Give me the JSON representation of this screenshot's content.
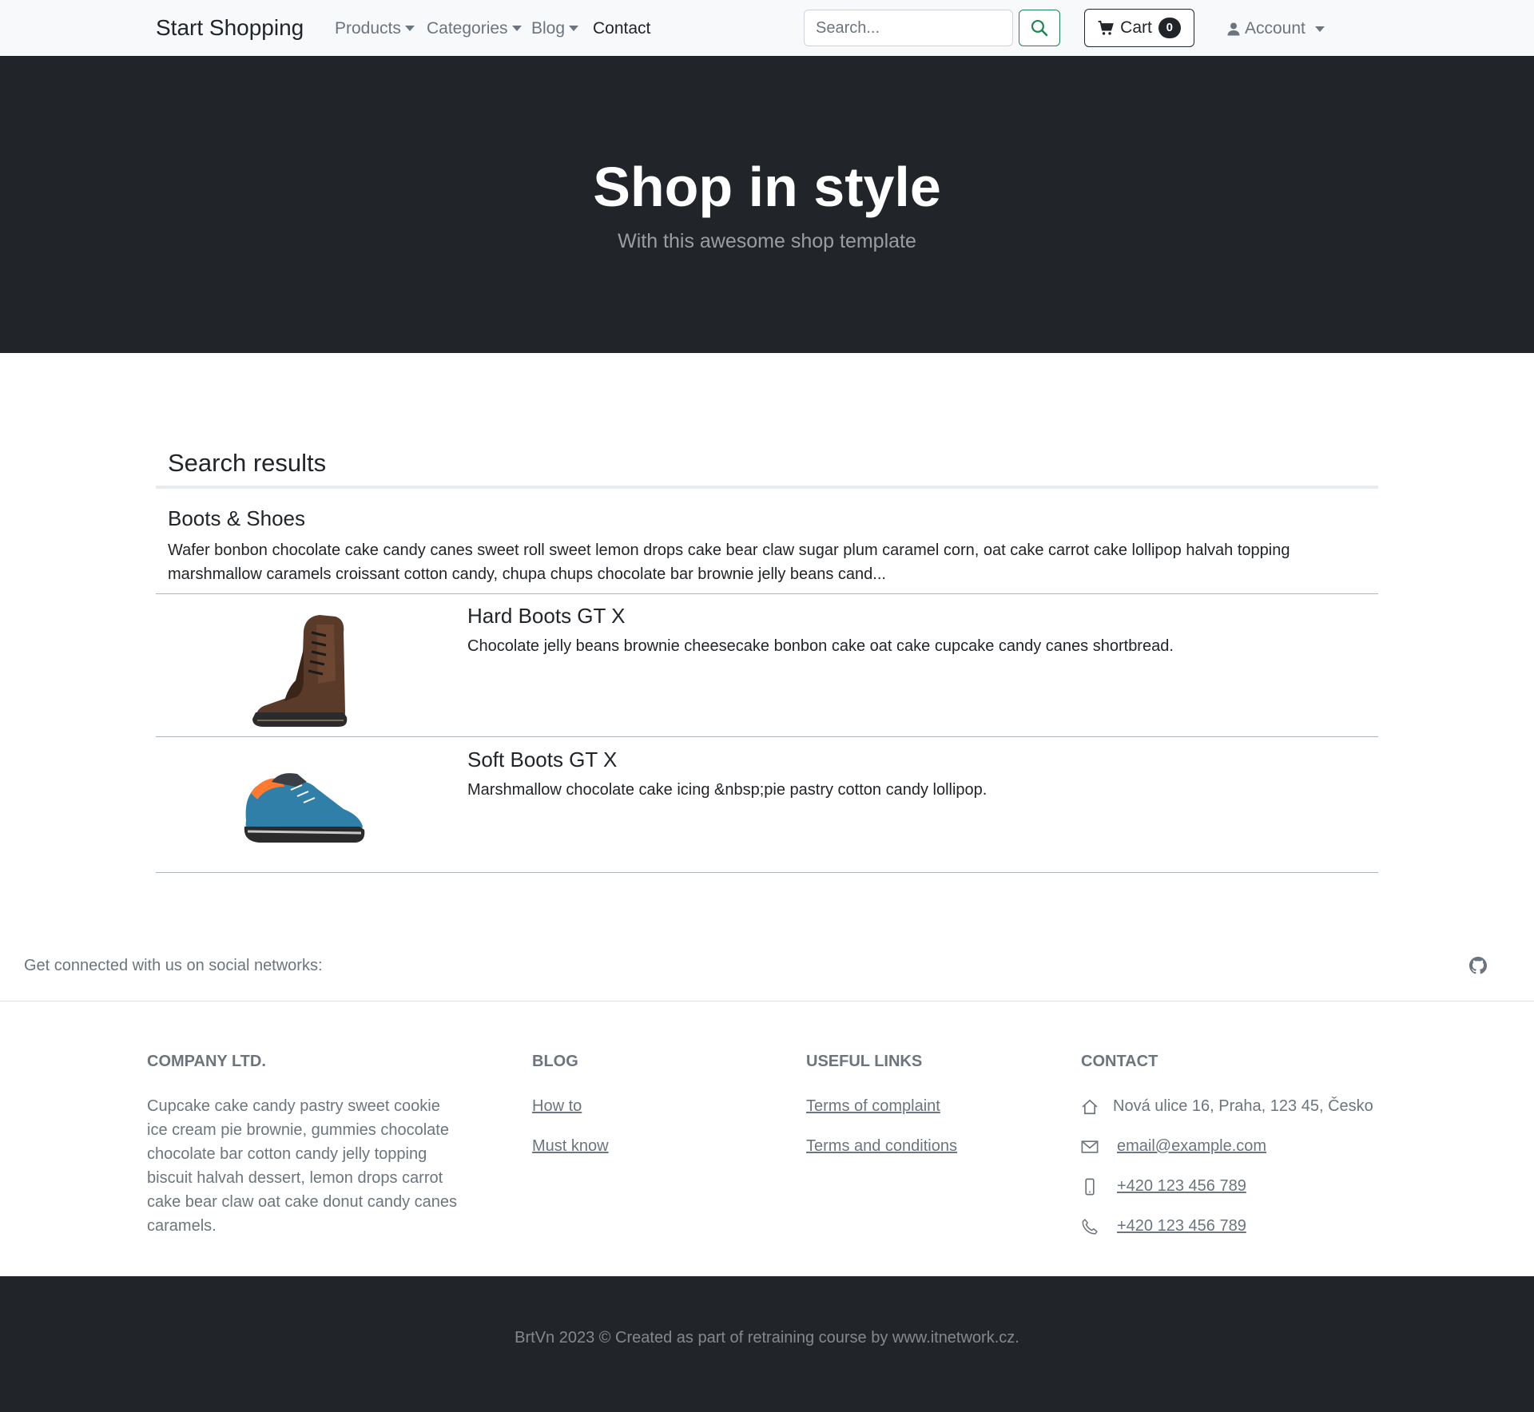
{
  "navbar": {
    "brand": "Start Shopping",
    "items": [
      {
        "label": "Products"
      },
      {
        "label": "Categories"
      },
      {
        "label": "Blog"
      },
      {
        "label": "Contact"
      }
    ],
    "search_placeholder": "Search...",
    "cart_label": "Cart",
    "cart_count": "0",
    "account_label": "Account"
  },
  "hero": {
    "title": "Shop in style",
    "subtitle": "With this awesome shop template"
  },
  "results": {
    "title": "Search results",
    "category": {
      "name": "Boots & Shoes",
      "description": "Wafer bonbon chocolate cake candy canes sweet roll sweet lemon drops cake bear claw sugar plum caramel corn, oat cake carrot cake lollipop halvah topping marshmallow caramels croissant cotton candy, chupa chups chocolate bar brownie jelly beans cand..."
    },
    "products": [
      {
        "name": "Hard Boots GT X",
        "description": "Chocolate jelly beans brownie cheesecake bonbon cake oat cake cupcake candy canes shortbread."
      },
      {
        "name": "Soft Boots GT X",
        "description": "Marshmallow chocolate cake icing &nbsp;pie pastry cotton candy lollipop."
      }
    ]
  },
  "social": {
    "text": "Get connected with us on social networks:"
  },
  "footer": {
    "company": {
      "heading": "COMPANY LTD.",
      "text": "Cupcake cake candy pastry sweet cookie ice cream pie brownie, gummies chocolate chocolate bar cotton candy jelly topping biscuit halvah dessert, lemon drops carrot cake bear claw oat cake donut candy canes caramels."
    },
    "blog": {
      "heading": "BLOG",
      "links": [
        "How to",
        "Must know"
      ]
    },
    "useful": {
      "heading": "USEFUL LINKS",
      "links": [
        "Terms of complaint",
        "Terms and conditions"
      ]
    },
    "contact": {
      "heading": "CONTACT",
      "address": "Nová ulice 16, Praha, 123 45, Česko",
      "email": "email@example.com",
      "mobile": "+420 123 456 789",
      "phone": "+420 123 456 789"
    },
    "copyright": "BrtVn 2023 © Created as part of retraining course by www.itnetwork.cz."
  },
  "colors": {
    "dark": "#212529",
    "navbar_bg": "#f8f9fa",
    "muted": "#6c757d",
    "success": "#198754"
  },
  "icons": [
    "search-icon",
    "cart-icon",
    "user-icon",
    "github-icon",
    "home-icon",
    "envelope-icon",
    "mobile-icon",
    "phone-icon"
  ]
}
